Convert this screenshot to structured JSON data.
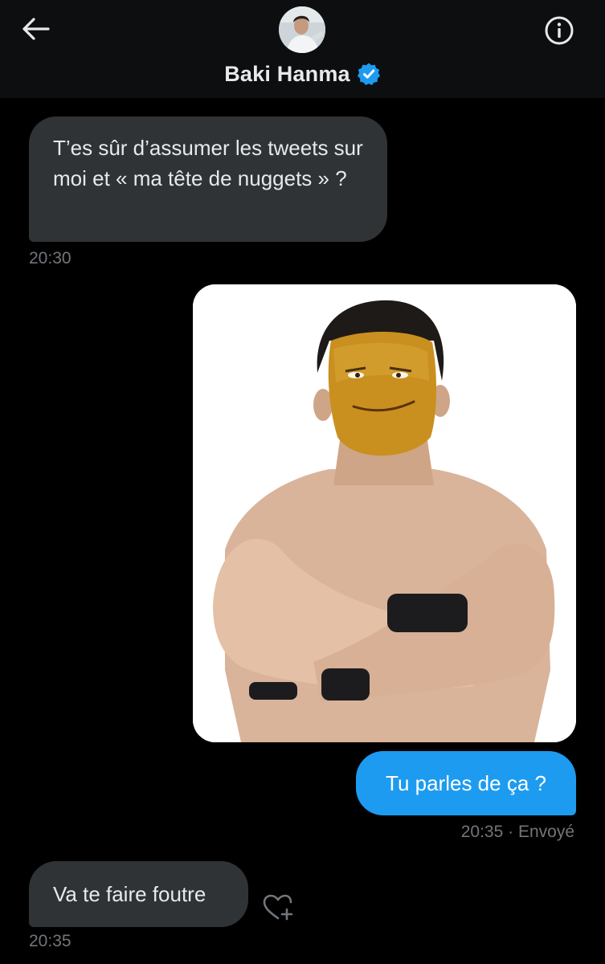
{
  "header": {
    "contact_name": "Baki Hanma",
    "back_icon": "arrow-left-icon",
    "info_icon": "info-circle-icon",
    "verified_icon": "verified-badge-icon"
  },
  "messages": [
    {
      "direction": "incoming",
      "text": "T’es sûr d’assumer les tweets sur moi et « ma tête de nuggets » ?",
      "time": "20:30"
    },
    {
      "direction": "outgoing",
      "type": "image",
      "image_desc": "photo"
    },
    {
      "direction": "outgoing",
      "text": "Tu parles de ça ?",
      "time": "20:35 · Envoyé"
    },
    {
      "direction": "incoming",
      "text": "Va te faire foutre",
      "time": "20:35"
    }
  ],
  "react_icon": "heart-add-icon",
  "colors": {
    "background": "#000000",
    "header": "#0d0e10",
    "incoming_bubble": "#2f3336",
    "outgoing_bubble": "#1d9bf0",
    "timestamp": "#71767b",
    "verified": "#1d9bf0"
  }
}
